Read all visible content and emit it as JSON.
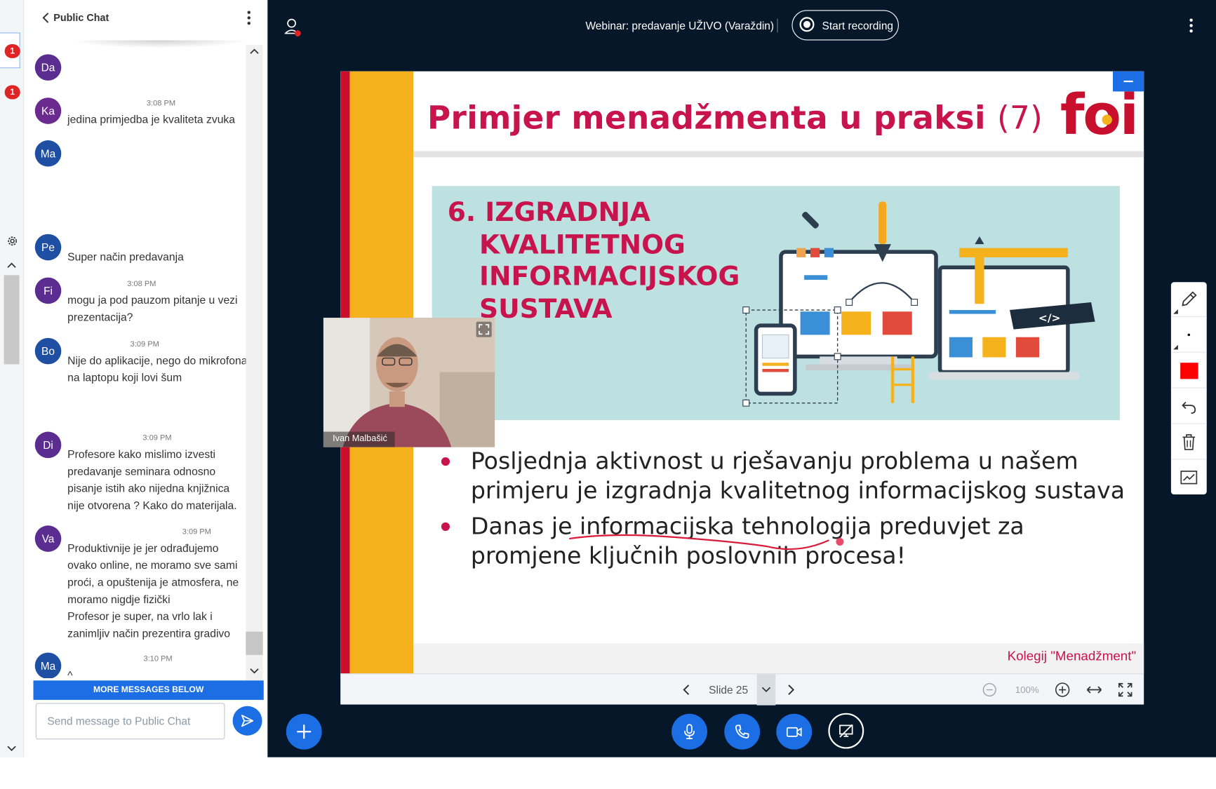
{
  "sidebar": {
    "badges": [
      "1",
      "1"
    ]
  },
  "chat": {
    "title": "Public Chat",
    "more_below": "MORE MESSAGES BELOW",
    "input_placeholder": "Send message to Public Chat",
    "messages": [
      {
        "initials": "Da",
        "time": "",
        "text": ""
      },
      {
        "initials": "Ka",
        "time": "3:08 PM",
        "text": "jedina primjedba je kvaliteta zvuka"
      },
      {
        "initials": "Ma",
        "time": "",
        "text": ""
      },
      {
        "initials": "Pe",
        "time": "",
        "text": "Super način predavanja"
      },
      {
        "initials": "Fi",
        "time": "3:08 PM",
        "text": "mogu ja pod pauzom pitanje u vezi prezentacija?"
      },
      {
        "initials": "Bo",
        "time": "3:09 PM",
        "text": "Nije do aplikacije, nego do mikrofona na laptopu koji lovi šum"
      },
      {
        "initials": "Di",
        "time": "3:09 PM",
        "text": "Profesore kako mislimo izvesti predavanje seminara odnosno pisanje istih ako nijedna knjižnica nije otvorena ? Kako do materijala."
      },
      {
        "initials": "Va",
        "time": "3:09 PM",
        "text": "Produktivnije je jer odrađujemo ovako online, ne moramo sve sami proći, a opuštenija je atmosfera, ne moramo nigdje fizički"
      },
      {
        "initials": "",
        "time": "",
        "text": "Profesor je super, na vrlo lak i zanimljiv način prezentira gradivo"
      },
      {
        "initials": "Ma",
        "time": "3:10 PM",
        "text": "^"
      }
    ]
  },
  "header": {
    "meeting_title": "Webinar: predavanje UŽIVO (Varaždin)",
    "record_label": "Start recording"
  },
  "slide": {
    "title": "Primjer menadžmenta u praksi",
    "title_num": "(7)",
    "logo": "foi",
    "banner_lines": [
      "6. IZGRADNJA",
      "KVALITETNOG",
      "INFORMACIJSKOG",
      "SUSTAVA"
    ],
    "bullets": [
      "Posljednja aktivnost u rješavanju problema u našem primjeru je izgradnja kvalitetnog informacijskog sustava",
      "Danas je informacijska tehnologija preduvjet za promjene ključnih poslovnih procesa!"
    ],
    "footer": "Kolegij \"Menadžment\""
  },
  "slide_controls": {
    "slide_label": "Slide 25",
    "zoom": "100%"
  },
  "webcam": {
    "name": "Ivan Malbašić"
  },
  "colors": {
    "accent": "#1b6ee3",
    "background": "#06172a",
    "slide_red": "#c8144d",
    "slide_yellow": "#f5b21d",
    "draw_color": "#ff0000"
  }
}
